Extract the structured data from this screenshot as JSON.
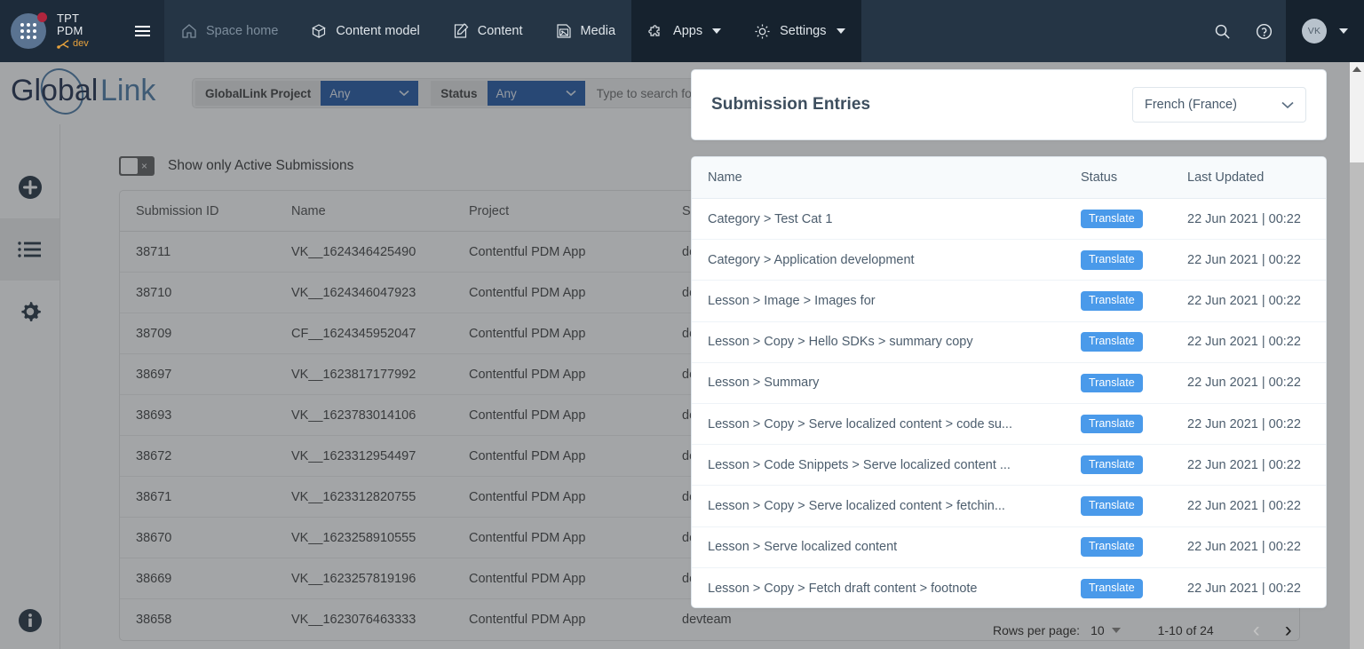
{
  "topnav": {
    "brand": {
      "line1": "TPT",
      "line2": "PDM",
      "env": "dev",
      "env_icon": "branch-icon"
    },
    "items": [
      {
        "label": "Space home",
        "icon": "home-icon",
        "state": "dim"
      },
      {
        "label": "Content model",
        "icon": "content-model-icon",
        "state": "normal"
      },
      {
        "label": "Content",
        "icon": "content-pencil-icon",
        "state": "normal"
      },
      {
        "label": "Media",
        "icon": "media-image-icon",
        "state": "normal"
      },
      {
        "label": "Apps",
        "icon": "puzzle-icon",
        "state": "shaded"
      },
      {
        "label": "Settings",
        "icon": "gear-icon",
        "state": "shaded"
      }
    ],
    "search_icon": "search-icon",
    "help_icon": "help-circle-icon",
    "avatar_initials": "VK"
  },
  "app": {
    "logo_text_a": "Global",
    "logo_text_b": "Link",
    "filters": {
      "project_label": "GlobalLink Project",
      "project_value": "Any",
      "status_label": "Status",
      "status_value": "Any",
      "search_placeholder": "Type to search for submission"
    },
    "rail": [
      {
        "name": "add-submission",
        "icon": "plus-circle-icon",
        "active": false
      },
      {
        "name": "submissions-list",
        "icon": "list-icon",
        "active": true
      },
      {
        "name": "settings",
        "icon": "gear-solid-icon",
        "active": false
      },
      {
        "name": "info",
        "icon": "info-circle-icon",
        "active": false
      }
    ],
    "toggle_label": "Show only Active Submissions",
    "toggle_state": "off",
    "toggle_glyph": "×",
    "table": {
      "columns": [
        "Submission ID",
        "Name",
        "Project",
        "Submitted"
      ],
      "rows": [
        {
          "id": "38711",
          "name": "VK__1624346425490",
          "project": "Contentful PDM App",
          "submitted": "devteam"
        },
        {
          "id": "38710",
          "name": "VK__1624346047923",
          "project": "Contentful PDM App",
          "submitted": "devteam"
        },
        {
          "id": "38709",
          "name": "CF__1624345952047",
          "project": "Contentful PDM App",
          "submitted": "devteam"
        },
        {
          "id": "38697",
          "name": "VK__1623817177992",
          "project": "Contentful PDM App",
          "submitted": "devteam"
        },
        {
          "id": "38693",
          "name": "VK__1623783014106",
          "project": "Contentful PDM App",
          "submitted": "devteam"
        },
        {
          "id": "38672",
          "name": "VK__1623312954497",
          "project": "Contentful PDM App",
          "submitted": "devteam"
        },
        {
          "id": "38671",
          "name": "VK__1623312820755",
          "project": "Contentful PDM App",
          "submitted": "devteam"
        },
        {
          "id": "38670",
          "name": "VK__1623258910555",
          "project": "Contentful PDM App",
          "submitted": "devteam"
        },
        {
          "id": "38669",
          "name": "VK__1623257819196",
          "project": "Contentful PDM App",
          "submitted": "devteam"
        },
        {
          "id": "38658",
          "name": "VK__1623076463333",
          "project": "Contentful PDM App",
          "submitted": "devteam"
        }
      ]
    }
  },
  "modal": {
    "title": "Submission Entries",
    "language": "French (France)",
    "columns": [
      "Name",
      "Status",
      "Last Updated"
    ],
    "rows": [
      {
        "name": "Category > Test Cat 1",
        "status": "Translate",
        "updated": "22 Jun 2021 | 00:22"
      },
      {
        "name": "Category > Application development",
        "status": "Translate",
        "updated": "22 Jun 2021 | 00:22"
      },
      {
        "name": "Lesson > Image > Images for",
        "status": "Translate",
        "updated": "22 Jun 2021 | 00:22"
      },
      {
        "name": "Lesson > Copy > Hello SDKs > summary copy",
        "status": "Translate",
        "updated": "22 Jun 2021 | 00:22"
      },
      {
        "name": "Lesson > Summary",
        "status": "Translate",
        "updated": "22 Jun 2021 | 00:22"
      },
      {
        "name": "Lesson > Copy > Serve localized content > code su...",
        "status": "Translate",
        "updated": "22 Jun 2021 | 00:22"
      },
      {
        "name": "Lesson > Code Snippets > Serve localized content ...",
        "status": "Translate",
        "updated": "22 Jun 2021 | 00:22"
      },
      {
        "name": "Lesson > Copy > Serve localized content > fetchin...",
        "status": "Translate",
        "updated": "22 Jun 2021 | 00:22"
      },
      {
        "name": "Lesson > Serve localized content",
        "status": "Translate",
        "updated": "22 Jun 2021 | 00:22"
      },
      {
        "name": "Lesson > Copy > Fetch draft content > footnote",
        "status": "Translate",
        "updated": "22 Jun 2021 | 00:22"
      }
    ],
    "pager": {
      "rows_per_page_label": "Rows per page:",
      "rows_per_page_value": "10",
      "range": "1-10 of 24",
      "prev_glyph": "‹",
      "next_glyph": "›"
    }
  },
  "colors": {
    "navbar": "#253545",
    "navbar_shaded": "#16222e",
    "filter_select": "#1f56a5",
    "badge": "#4a9aea",
    "env": "#e8a33d"
  }
}
